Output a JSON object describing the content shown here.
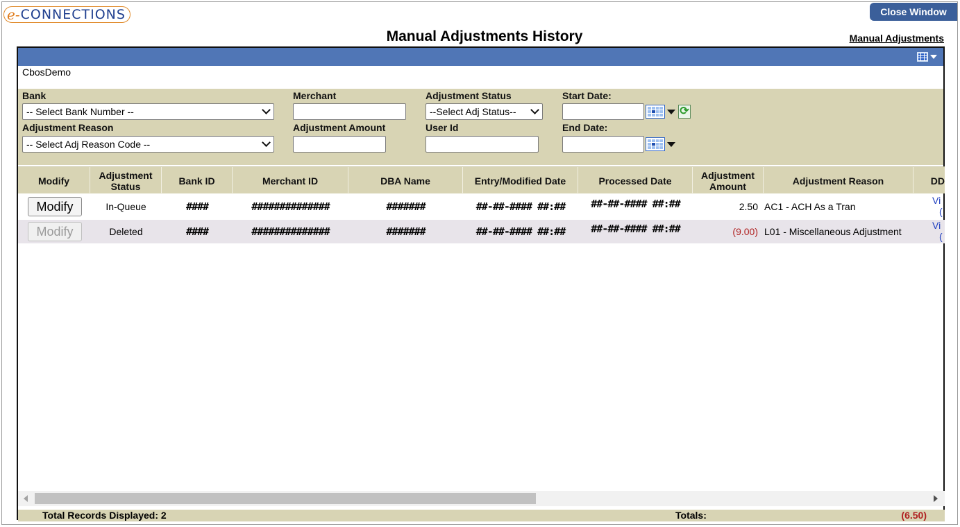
{
  "logo": {
    "e": "e-",
    "rest": "CONNECTIONS"
  },
  "close_window": "Close Window",
  "page_title": "Manual Adjustments History",
  "top_link": "Manual Adjustments",
  "org_name": "CbosDemo",
  "filters": {
    "bank_label": "Bank",
    "bank_value": "-- Select Bank Number --",
    "merchant_label": "Merchant",
    "merchant_value": "",
    "adj_status_label": "Adjustment Status",
    "adj_status_value": "--Select Adj Status--",
    "start_date_label": "Start Date:",
    "start_date_value": "",
    "adj_reason_label": "Adjustment Reason",
    "adj_reason_value": "-- Select Adj Reason Code --",
    "adj_amount_label": "Adjustment Amount",
    "adj_amount_value": "",
    "user_id_label": "User Id",
    "user_id_value": "",
    "end_date_label": "End Date:",
    "end_date_value": ""
  },
  "table": {
    "headers": {
      "modify": "Modify",
      "adj_status_1": "Adjustment",
      "adj_status_2": "Status",
      "bank_id": "Bank ID",
      "merchant_id": "Merchant ID",
      "dba_name": "DBA Name",
      "entry_date": "Entry/Modified Date",
      "processed_date": "Processed Date",
      "adj_amount_1": "Adjustment",
      "adj_amount_2": "Amount",
      "adj_reason": "Adjustment Reason",
      "dd": "DD"
    },
    "rows": [
      {
        "modify": "Modify",
        "status": "In-Queue",
        "bank_id": "####",
        "merchant_id": "##############",
        "dba_name": "#######",
        "entry_date": "##-##-#### ##:##",
        "processed_date": "##-##-#### ##:##",
        "amount": "2.50",
        "reason": "AC1 - ACH As a Tran",
        "link_1": "Vi",
        "link_2": "("
      },
      {
        "modify": "Modify",
        "status": "Deleted",
        "bank_id": "####",
        "merchant_id": "##############",
        "dba_name": "#######",
        "entry_date": "##-##-#### ##:##",
        "processed_date": "##-##-#### ##:##",
        "amount": "(9.00)",
        "reason": "L01 - Miscellaneous Adjustment",
        "link_1": "Vi",
        "link_2": "("
      }
    ]
  },
  "footer": {
    "records_label": "Total Records Displayed:  2",
    "totals_label": "Totals:",
    "totals_value": "(6.50)"
  },
  "colors": {
    "header_blue": "#5076b6",
    "filter_bg": "#d8d4b4",
    "negative": "#b02020",
    "close_button": "#3b5f9a"
  }
}
